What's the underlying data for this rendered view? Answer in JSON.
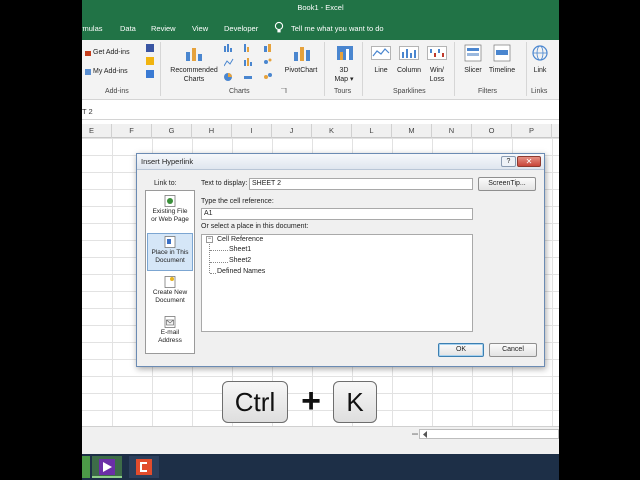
{
  "window": {
    "title": "Book1  -  Excel"
  },
  "tabs": [
    "rmulas",
    "Data",
    "Review",
    "View",
    "Developer"
  ],
  "tell_me": "Tell me what you want to do",
  "ribbon": {
    "addins": {
      "get": "Get Add-ins",
      "my": "My Add-ins",
      "label": "Add-ins"
    },
    "recommended": {
      "line1": "Recommended",
      "line2": "Charts"
    },
    "charts_label": "Charts",
    "pivotchart": "PivotChart",
    "map3d": {
      "line1": "3D",
      "line2": "Map",
      "arrow": "▾"
    },
    "tours_label": "Tours",
    "sparklines": {
      "line": "Line",
      "column": "Column",
      "winloss1": "Win/",
      "winloss2": "Loss",
      "label": "Sparklines"
    },
    "filters": {
      "slicer": "Slicer",
      "timeline": "Timeline",
      "label": "Filters"
    },
    "links": {
      "link": "Link",
      "label": "Links"
    }
  },
  "formula_bar": {
    "name_fragment": "T 2"
  },
  "columns": [
    "E",
    "F",
    "G",
    "H",
    "I",
    "J",
    "K",
    "L",
    "M",
    "N",
    "O",
    "P"
  ],
  "dialog": {
    "title": "Insert Hyperlink",
    "help": "?",
    "close": "✕",
    "link_to": "Link to:",
    "text_label": "Text to display:",
    "text_value": "SHEET 2",
    "screentip": "ScreenTip...",
    "cell_ref_label": "Type the cell reference:",
    "cell_ref_value": "A1",
    "place_label": "Or select a place in this document:",
    "link_items": [
      {
        "line1": "Existing File",
        "line2": "or Web Page"
      },
      {
        "line1": "Place in This",
        "line2": "Document"
      },
      {
        "line1": "Create New",
        "line2": "Document"
      },
      {
        "line1": "E-mail",
        "line2": "Address"
      }
    ],
    "tree": {
      "root_toggle": "−",
      "cell_reference": "Cell Reference",
      "sheet1": "Sheet1",
      "sheet2": "Sheet2",
      "defined_names": "Defined Names"
    },
    "ok": "OK",
    "cancel": "Cancel"
  },
  "keys": {
    "ctrl": "Ctrl",
    "plus": "+",
    "k": "K"
  },
  "colors": {
    "excel_green": "#217346",
    "selected": "#d5e6f7",
    "ok_border": "#3c7fb1"
  }
}
